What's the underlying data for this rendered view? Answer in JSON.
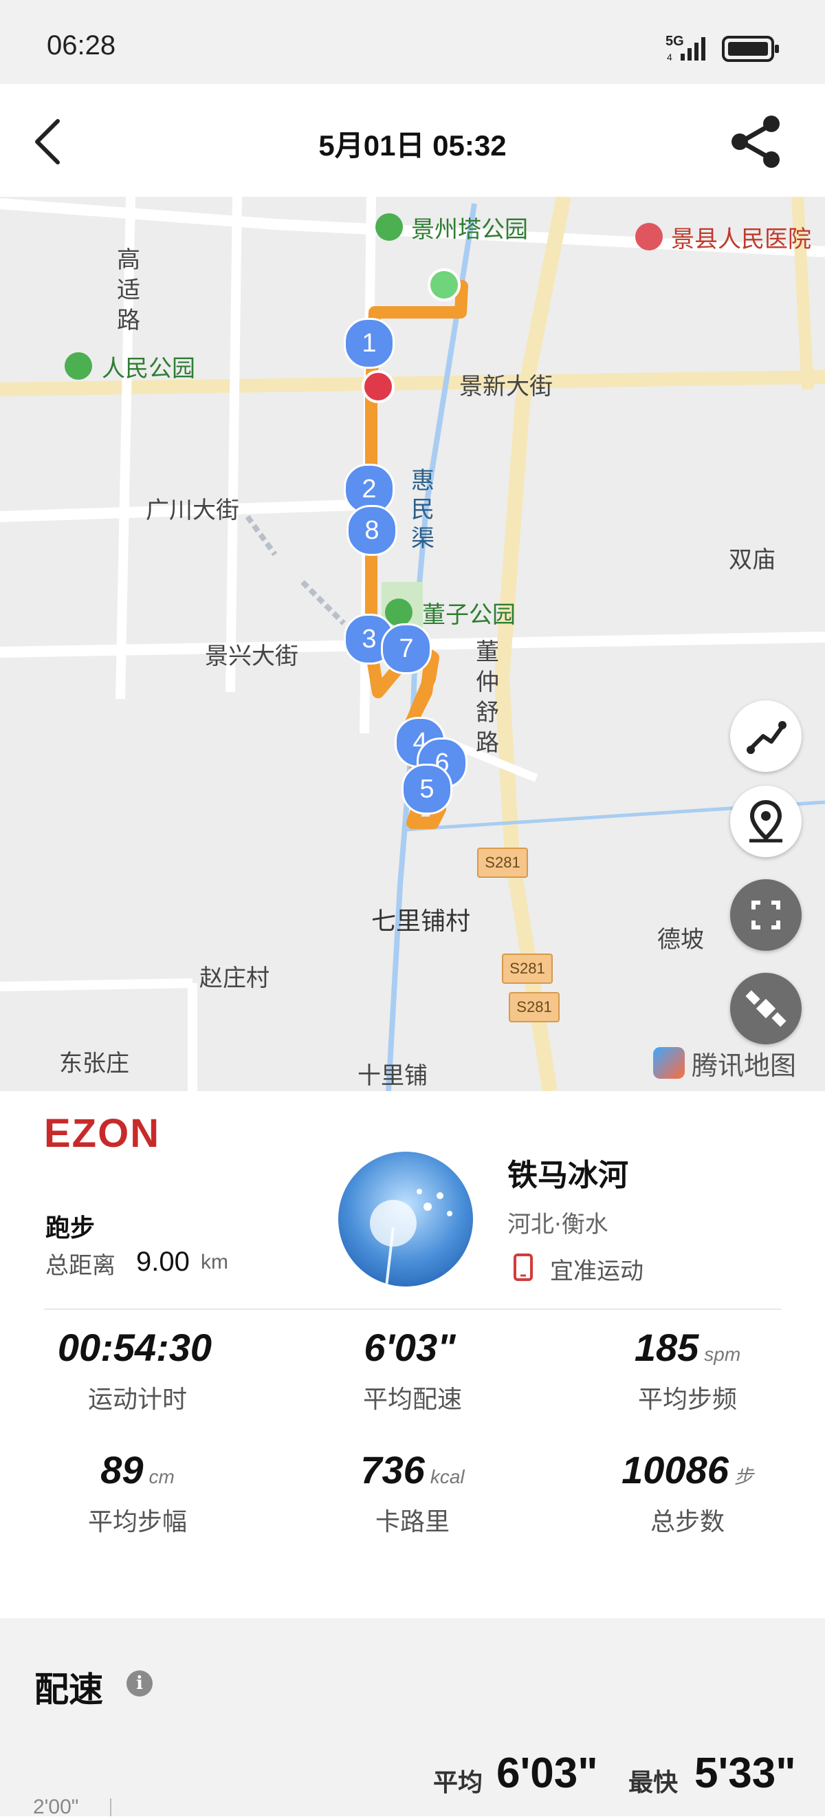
{
  "status_bar": {
    "time": "06:28",
    "network": "5G",
    "network_sub": "4"
  },
  "header": {
    "title": "5月01日  05:32"
  },
  "map": {
    "road_labels": {
      "gaoshi": "高适路",
      "jingxin": "景新大街",
      "guangchuan": "广川大街",
      "jingxing": "景兴大街",
      "dongzhongshu": "董仲舒路",
      "huiminqu": "惠民渠",
      "shuangmiao": "双庙",
      "qilipucun": "七里铺村",
      "depo": "德坡",
      "zhaozhuangcun": "赵庄村",
      "dongzhangzhuang": "东张庄",
      "shilipu": "十里铺"
    },
    "pois": {
      "jingzhouta": "景州塔公园",
      "hospital": "景县人民医院",
      "renmin_park": "人民公园",
      "dongzi_park": "董子公园"
    },
    "highway": "S281",
    "markers": [
      "1",
      "2",
      "8",
      "3",
      "7",
      "4",
      "6",
      "5"
    ],
    "attribution": "腾讯地图",
    "colors": {
      "route": "#f29b2e",
      "marker": "#5b8ff0",
      "start": "#6fd47b",
      "end": "#e0394a"
    }
  },
  "summary": {
    "brand": "EZON",
    "sport": "跑步",
    "distance_label": "总距离",
    "distance_value": "9.00",
    "distance_unit": "km",
    "user_name": "铁马冰河",
    "user_location": "河北·衡水",
    "device_label": "宜准运动",
    "stats": [
      {
        "value": "00:54:30",
        "unit": "",
        "label": "运动计时"
      },
      {
        "value": "6'03\"",
        "unit": "",
        "label": "平均配速"
      },
      {
        "value": "185",
        "unit": "spm",
        "label": "平均步频"
      },
      {
        "value": "89",
        "unit": "cm",
        "label": "平均步幅"
      },
      {
        "value": "736",
        "unit": "kcal",
        "label": "卡路里"
      },
      {
        "value": "10086",
        "unit": "步",
        "label": "总步数"
      }
    ]
  },
  "pace": {
    "title": "配速",
    "avg_label": "平均",
    "avg_value": "6'03\"",
    "best_label": "最快",
    "best_value": "5'33\"",
    "axis_top": "2'00\""
  }
}
